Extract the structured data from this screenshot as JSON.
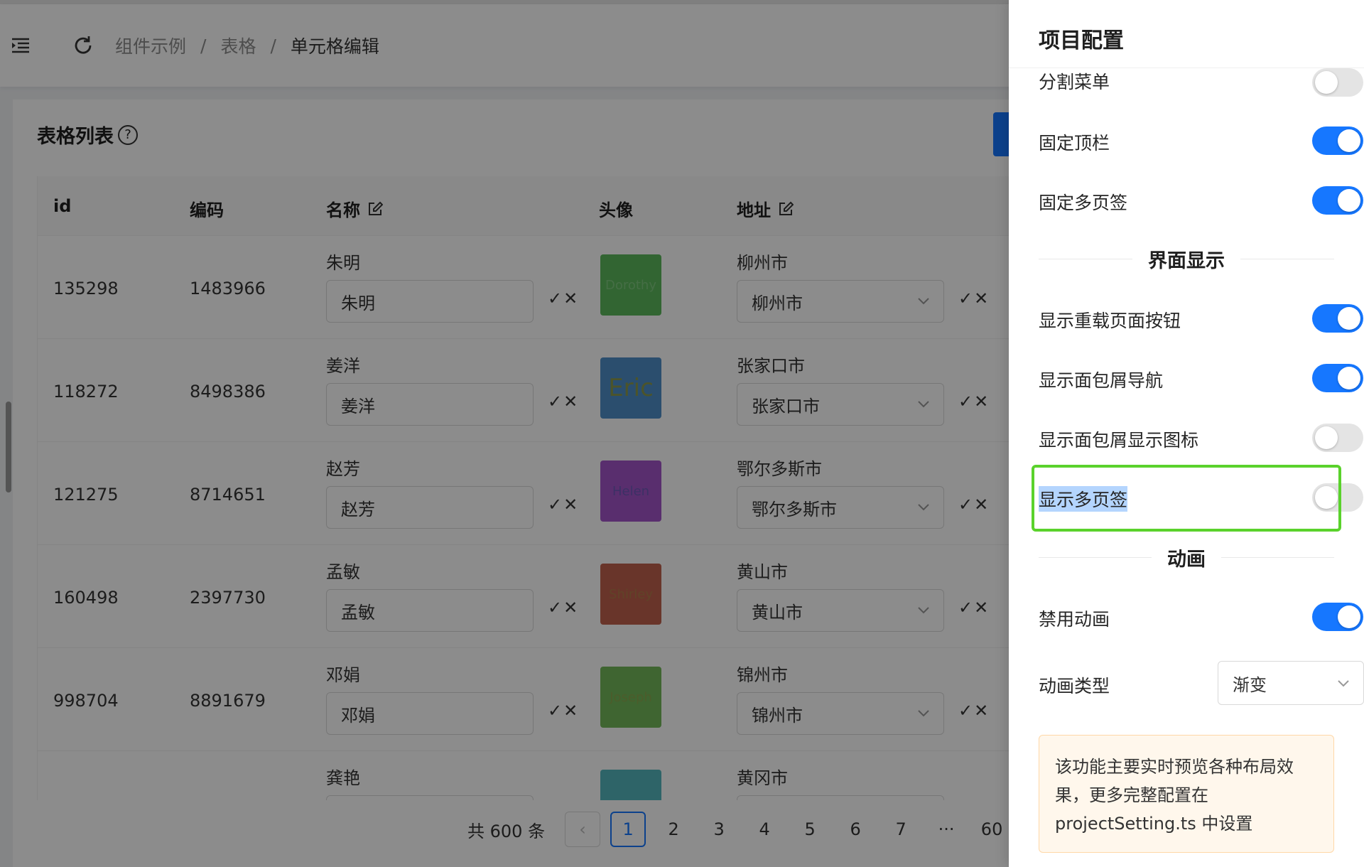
{
  "header": {
    "breadcrumb": [
      "组件示例",
      "表格",
      "单元格编辑"
    ],
    "separator": "/"
  },
  "card": {
    "title": "表格列表",
    "help_icon": "?"
  },
  "table": {
    "columns": [
      "id",
      "编码",
      "名称",
      "头像",
      "地址"
    ],
    "rows": [
      {
        "id": "135298",
        "code": "1483966",
        "name": "朱明",
        "name_input": "朱明",
        "avatar_text": "Dorothy",
        "avatar_color": "#5cb85c",
        "avatar_text_color": "#7ec87e",
        "addr": "柳州市",
        "addr_select": "柳州市"
      },
      {
        "id": "118272",
        "code": "8498386",
        "name": "姜洋",
        "name_input": "姜洋",
        "avatar_text": "Eric",
        "avatar_color": "#4f8fc9",
        "avatar_text_color": "#8a9a4e",
        "addr": "张家口市",
        "addr_select": "张家口市"
      },
      {
        "id": "121275",
        "code": "8714651",
        "name": "赵芳",
        "name_input": "赵芳",
        "avatar_text": "Helen",
        "avatar_color": "#a355c8",
        "avatar_text_color": "#6e58b8",
        "addr": "鄂尔多斯市",
        "addr_select": "鄂尔多斯市"
      },
      {
        "id": "160498",
        "code": "2397730",
        "name": "孟敏",
        "name_input": "孟敏",
        "avatar_text": "Shirley",
        "avatar_color": "#c0614d",
        "avatar_text_color": "#b07a4a",
        "addr": "黄山市",
        "addr_select": "黄山市"
      },
      {
        "id": "998704",
        "code": "8891679",
        "name": "邓娟",
        "name_input": "邓娟",
        "avatar_text": "Joseph",
        "avatar_color": "#73b85a",
        "avatar_text_color": "#8aa84f",
        "addr": "锦州市",
        "addr_select": "锦州市"
      },
      {
        "id": "",
        "code": "",
        "name": "龚艳",
        "name_input": "",
        "avatar_text": "",
        "avatar_color": "#55b7bd",
        "avatar_text_color": "#55b7bd",
        "addr": "黄冈市",
        "addr_select": ""
      }
    ],
    "confirm_cancel": "✓✕"
  },
  "pagination": {
    "total": "共 600 条",
    "prev": "‹",
    "pages": [
      "1",
      "2",
      "3",
      "4",
      "5",
      "6",
      "7",
      "···",
      "60"
    ],
    "current": "1"
  },
  "drawer": {
    "title": "项目配置",
    "rows": [
      {
        "label": "分割菜单",
        "on": false
      },
      {
        "label": "固定顶栏",
        "on": true
      },
      {
        "label": "固定多页签",
        "on": true
      }
    ],
    "section_display": "界面显示",
    "display_rows": [
      {
        "label": "显示重载页面按钮",
        "on": true
      },
      {
        "label": "显示面包屑导航",
        "on": true
      },
      {
        "label": "显示面包屑显示图标",
        "on": false
      },
      {
        "label": "显示多页签",
        "on": false
      }
    ],
    "section_anim": "动画",
    "disable_anim": {
      "label": "禁用动画",
      "on": true
    },
    "anim_type": {
      "label": "动画类型",
      "value": "渐变"
    },
    "notice": "该功能主要实时预览各种布局效果，更多完整配置在 projectSetting.ts 中设置"
  },
  "colors": {
    "primary": "#1677ff",
    "highlight_border": "#5ad22c",
    "notice_bg": "#fff7ec"
  },
  "icons": {
    "menu": "menu-fold-icon",
    "reload": "reload-icon",
    "edit": "edit-icon",
    "chevron": "chevron-down-icon"
  }
}
